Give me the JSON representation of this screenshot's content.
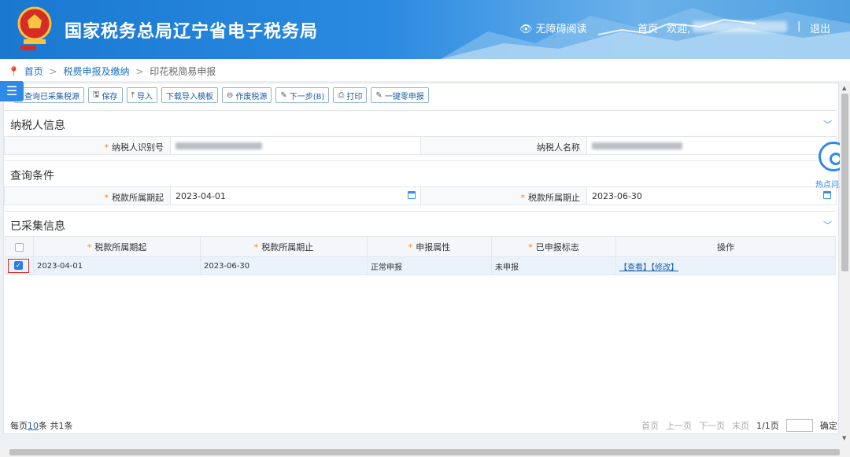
{
  "header": {
    "title": "国家税务总局辽宁省电子税务局",
    "accessibility": "无障碍阅读",
    "home": "首页",
    "welcome": "欢迎,",
    "separator": "|",
    "logout": "退出",
    "colors": {
      "bar": "#1a78d0",
      "text": "#ffffff"
    }
  },
  "breadcrumb": {
    "home": "首页",
    "sep": ">",
    "level2": "税费申报及缴纳",
    "level3": "印花税简易申报"
  },
  "menu_toggle": "☰",
  "toolbar": {
    "query": "查询已采集税源",
    "save": "保存",
    "import": "导入",
    "download_template": "下载导入模板",
    "void": "作废税源",
    "next": "下一步(B)",
    "print": "打印",
    "zero_declare": "一键零申报"
  },
  "taxpayer": {
    "section_title": "纳税人信息",
    "id_label": "纳税人识别号",
    "name_label": "纳税人名称"
  },
  "query": {
    "section_title": "查询条件",
    "start_label": "税款所属期起",
    "start_value": "2023-04-01",
    "end_label": "税款所属期止",
    "end_value": "2023-06-30"
  },
  "collected": {
    "section_title": "已采集信息",
    "columns": [
      "税款所属期起",
      "税款所属期止",
      "申报属性",
      "已申报标志",
      "操作"
    ],
    "rows": [
      {
        "checked": true,
        "start": "2023-04-01",
        "end": "2023-06-30",
        "attr": "正常申报",
        "flag": "未申报",
        "view": "【查看】",
        "edit": "【修改】"
      }
    ]
  },
  "pager": {
    "per_page_prefix": "每页",
    "per_page": "10",
    "per_page_suffix": "条 共1条",
    "first": "首页",
    "prev": "上一页",
    "next": "下一页",
    "last": "末页",
    "current": "1/1页",
    "confirm": "确定"
  },
  "hot_questions": "热点问题",
  "required_mark": "*",
  "check_mark": "✓",
  "chevron": "﹀"
}
